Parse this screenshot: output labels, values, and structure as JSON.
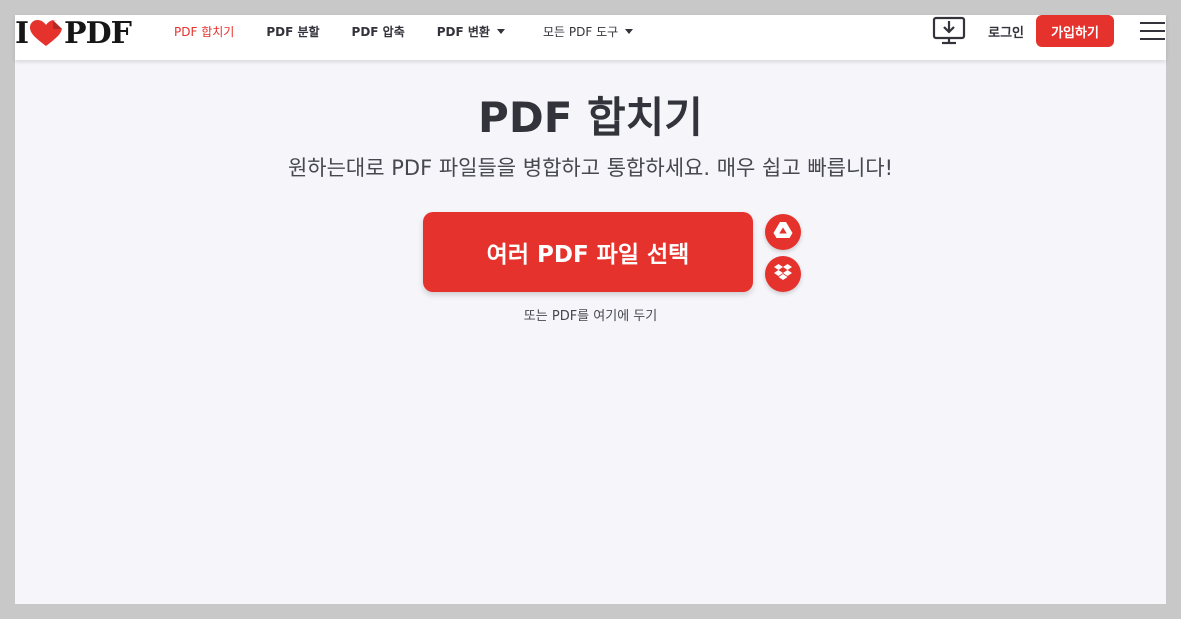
{
  "logo": {
    "letter": "I",
    "word": "PDF"
  },
  "nav": {
    "items": [
      {
        "label": "PDF 합치기",
        "active": true,
        "dropdown": false
      },
      {
        "label": "PDF 분할",
        "active": false,
        "dropdown": false
      },
      {
        "label": "PDF 압축",
        "active": false,
        "dropdown": false
      },
      {
        "label": "PDF 변환",
        "active": false,
        "dropdown": true
      },
      {
        "label": "모든 PDF 도구",
        "active": false,
        "dropdown": true
      }
    ],
    "desktop_icon": "desktop-download-icon",
    "login_label": "로그인",
    "signup_label": "가입하기",
    "menu_icon": "hamburger-menu-icon"
  },
  "hero": {
    "title": "PDF 합치기",
    "subtitle": "원하는대로 PDF 파일들을 병합하고 통합하세요. 매우 쉽고 빠릅니다!",
    "select_button": "여러 PDF 파일 선택",
    "cloud_icons": [
      "google-drive-icon",
      "dropbox-icon"
    ],
    "drop_hint": "또는 PDF를 여기에 두기"
  },
  "colors": {
    "accent": "#e5322d",
    "text": "#33333b",
    "background": "#f5f5fa"
  }
}
